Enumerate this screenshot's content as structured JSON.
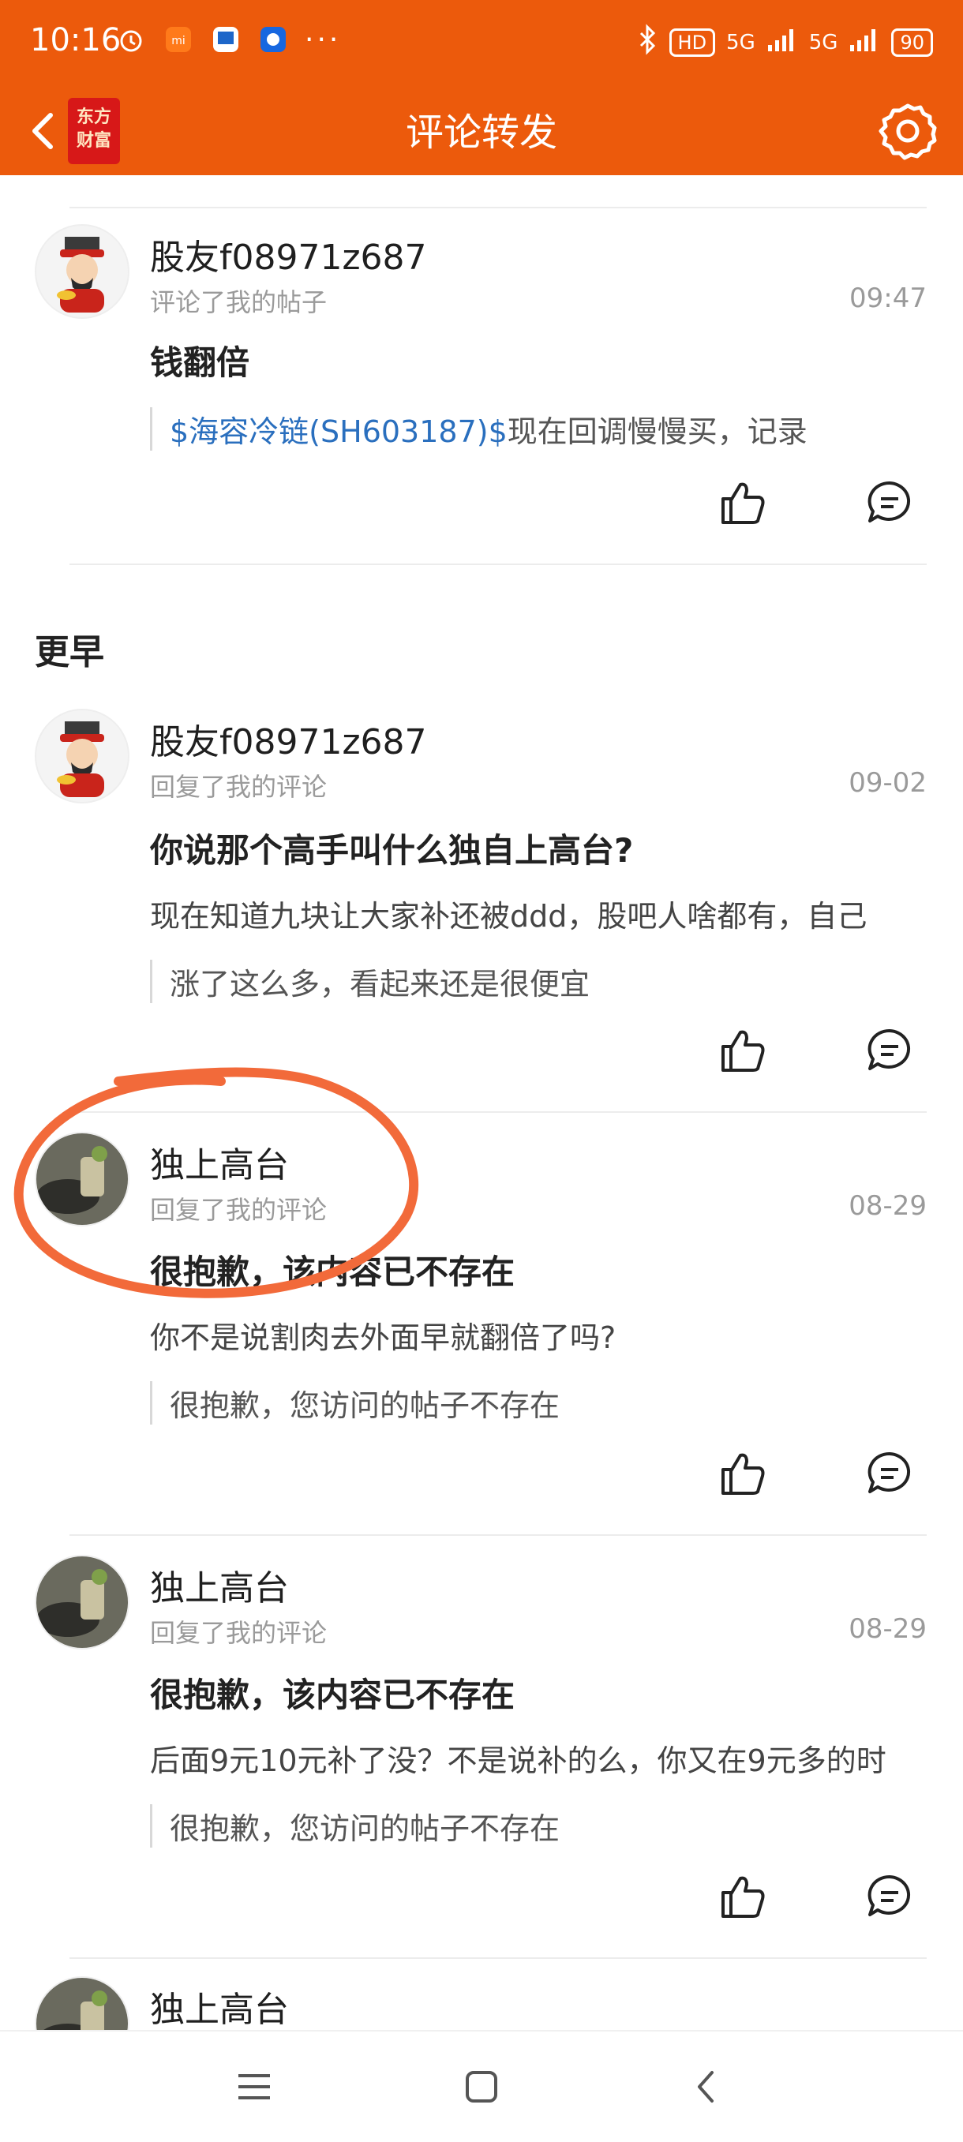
{
  "status_bar": {
    "time": "10:16",
    "network_left": "5G",
    "network_right": "5G",
    "hd": "HD",
    "battery": "90"
  },
  "nav": {
    "title": "评论转发",
    "logo_line1": "东方",
    "logo_line2": "财富"
  },
  "section_earlier": "更早",
  "items": [
    {
      "user": "股友f08971z687",
      "action": "评论了我的帖子",
      "time": "09:47",
      "text": "钱翻倍",
      "quote_link": "$海容冷链(SH603187)$",
      "quote_rest": "现在回调慢慢买，记录"
    },
    {
      "user": "股友f08971z687",
      "action": "回复了我的评论",
      "time": "09-02",
      "text": "你说那个高手叫什么独自上高台?",
      "reply": "现在知道九块让大家补还被ddd，股吧人啥都有，自己",
      "quote": "涨了这么多，看起来还是很便宜"
    },
    {
      "user": "独上高台",
      "action": "回复了我的评论",
      "time": "08-29",
      "text": " 很抱歉，该内容已不存在",
      "reply": "你不是说割肉去外面早就翻倍了吗?",
      "quote": "很抱歉，您访问的帖子不存在"
    },
    {
      "user": "独上高台",
      "action": "回复了我的评论",
      "time": "08-29",
      "text": " 很抱歉，该内容已不存在",
      "reply": "后面9元10元补了没？不是说补的么，你又在9元多的时",
      "quote": "很抱歉，您访问的帖子不存在"
    },
    {
      "user": "独上高台"
    }
  ],
  "icons": {
    "back": "chevron-left-icon",
    "settings": "gear-icon",
    "like": "thumbs-up-icon",
    "comment": "comment-bubble-icon",
    "menu": "menu-icon",
    "home": "home-square-icon",
    "back_nav": "back-triangle-icon"
  },
  "colors": {
    "accent": "#ec5a0c",
    "link": "#2a6fbe",
    "annotation": "#f26a3a"
  }
}
